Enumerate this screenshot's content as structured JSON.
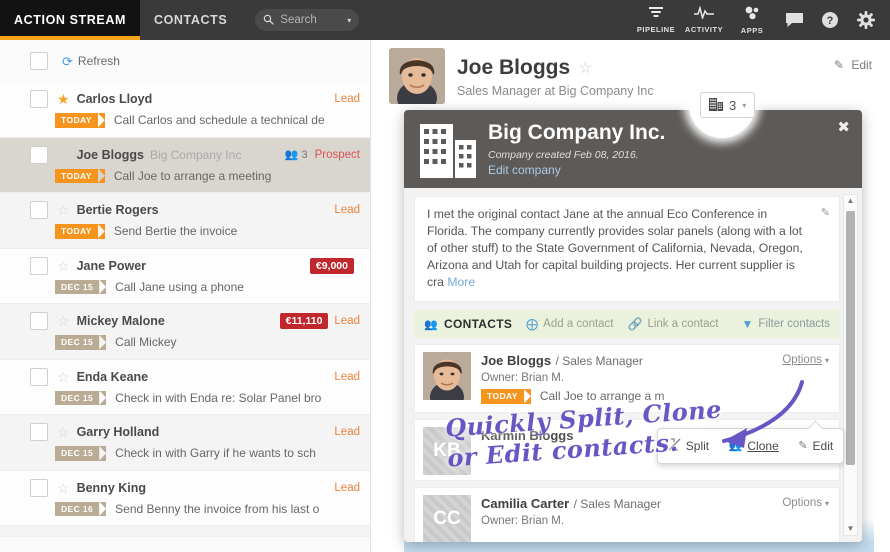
{
  "nav": {
    "tabs": [
      {
        "label": "ACTION STREAM",
        "active": true
      },
      {
        "label": "CONTACTS",
        "active": false
      }
    ],
    "search": {
      "placeholder": "Search",
      "icon": "search-icon",
      "caret": "▾"
    },
    "items": [
      {
        "label": "PIPELINE",
        "icon": "pipeline-icon"
      },
      {
        "label": "ACTIVITY",
        "icon": "activity-icon"
      },
      {
        "label": "APPS",
        "icon": "apps-icon"
      }
    ],
    "icons": [
      {
        "name": "chat-icon",
        "glyph": "⬛"
      },
      {
        "name": "help-icon",
        "glyph": "?"
      },
      {
        "name": "settings-icon",
        "glyph": "⚙"
      }
    ]
  },
  "stream": {
    "refresh_label": "Refresh",
    "refresh_icon": "refresh-icon",
    "rows": [
      {
        "name": "Carlos Lloyd",
        "company": "",
        "starred": true,
        "status": "Lead",
        "group": "",
        "money": "",
        "date": "TODAY",
        "date_kind": "today",
        "task": "Call Carlos and schedule a technical de",
        "selected": false
      },
      {
        "name": "Joe Bloggs",
        "company": "Big Company Inc",
        "starred": false,
        "status": "Prospect",
        "group": "3",
        "money": "",
        "date": "TODAY",
        "date_kind": "today",
        "task": "Call Joe to arrange a meeting",
        "selected": true
      },
      {
        "name": "Bertie Rogers",
        "company": "",
        "starred": false,
        "status": "Lead",
        "group": "",
        "money": "",
        "date": "TODAY",
        "date_kind": "today",
        "task": "Send Bertie the invoice",
        "selected": false
      },
      {
        "name": "Jane Power",
        "company": "",
        "starred": false,
        "status": "",
        "group": "",
        "money": "€9,000",
        "date": "DEC 15",
        "date_kind": "past",
        "task": "Call Jane using a phone",
        "selected": false
      },
      {
        "name": "Mickey Malone",
        "company": "",
        "starred": false,
        "status": "Lead",
        "group": "",
        "money": "€11,110",
        "date": "DEC 15",
        "date_kind": "past",
        "task": "Call Mickey",
        "selected": false
      },
      {
        "name": "Enda Keane",
        "company": "",
        "starred": false,
        "status": "Lead",
        "group": "",
        "money": "",
        "date": "DEC 15",
        "date_kind": "past",
        "task": "Check in with Enda re: Solar Panel bro",
        "selected": false
      },
      {
        "name": "Garry Holland",
        "company": "",
        "starred": false,
        "status": "Lead",
        "group": "",
        "money": "",
        "date": "DEC 15",
        "date_kind": "past",
        "task": "Check in with Garry if he wants to sch",
        "selected": false
      },
      {
        "name": "Benny King",
        "company": "",
        "starred": false,
        "status": "Lead",
        "group": "",
        "money": "",
        "date": "DEC 16",
        "date_kind": "past",
        "task": "Send Benny the invoice from his last o",
        "selected": false
      }
    ]
  },
  "person": {
    "name": "Joe Bloggs",
    "star_icon": "star-outline-icon",
    "subtitle": "Sales Manager at Big Company Inc",
    "edit_label": "Edit",
    "edit_icon": "pencil-icon",
    "company_count": "3",
    "company_icon": "building-icon",
    "company_caret": "▾"
  },
  "modal": {
    "title": "Big Company Inc.",
    "created": "Company created Feb 08, 2016.",
    "edit_company": "Edit company",
    "close_icon": "close-icon",
    "logo_icon": "building-icon",
    "note": "I met the original contact Jane at the annual Eco Conference in Florida. The company currently provides solar panels (along with a lot of other stuff) to the State Government of California, Nevada, Oregon, Arizona and Utah for capital building projects. Her current supplier is cra",
    "note_more": "More",
    "note_edit_icon": "pencil-icon",
    "contacts_header": "CONTACTS",
    "contacts_header_icon": "people-icon",
    "actions": [
      {
        "label": "Add a contact",
        "icon": "plus-circle-icon"
      },
      {
        "label": "Link a contact",
        "icon": "link-icon"
      },
      {
        "label": "Filter contacts",
        "icon": "funnel-icon"
      }
    ],
    "options_label": "Options",
    "options_caret": "▾",
    "contacts": [
      {
        "name": "Joe Bloggs",
        "role": "/ Sales Manager",
        "owner": "Owner: Brian M.",
        "date": "TODAY",
        "task": "Call Joe to arrange a m",
        "initials": "",
        "photo": true
      },
      {
        "name": "Karmin Bloggs",
        "role": "",
        "owner": "",
        "date": "",
        "task": "",
        "initials": "KB",
        "photo": false
      },
      {
        "name": "Camilia Carter",
        "role": "/ Sales Manager",
        "owner": "Owner: Brian M.",
        "date": "",
        "task": "",
        "initials": "CC",
        "photo": false
      }
    ],
    "options_menu": [
      {
        "label": "Split",
        "icon": "split-icon",
        "active": false
      },
      {
        "label": "Clone",
        "icon": "clone-icon",
        "active": true
      },
      {
        "label": "Edit",
        "icon": "pencil-icon",
        "active": false
      }
    ]
  },
  "annotation": {
    "line1": "Quickly Split, Clone",
    "line2": "or Edit contacts.",
    "color": "#6657c4"
  },
  "colors": {
    "accent_orange": "#f5a21d",
    "nav_bg": "#3a3a3a",
    "tab_active_bg": "#121212",
    "money_red": "#c0282d",
    "modal_header": "#5d5a57",
    "link_blue": "#4e9fd6",
    "contacts_bar": "#eaf1dc"
  }
}
